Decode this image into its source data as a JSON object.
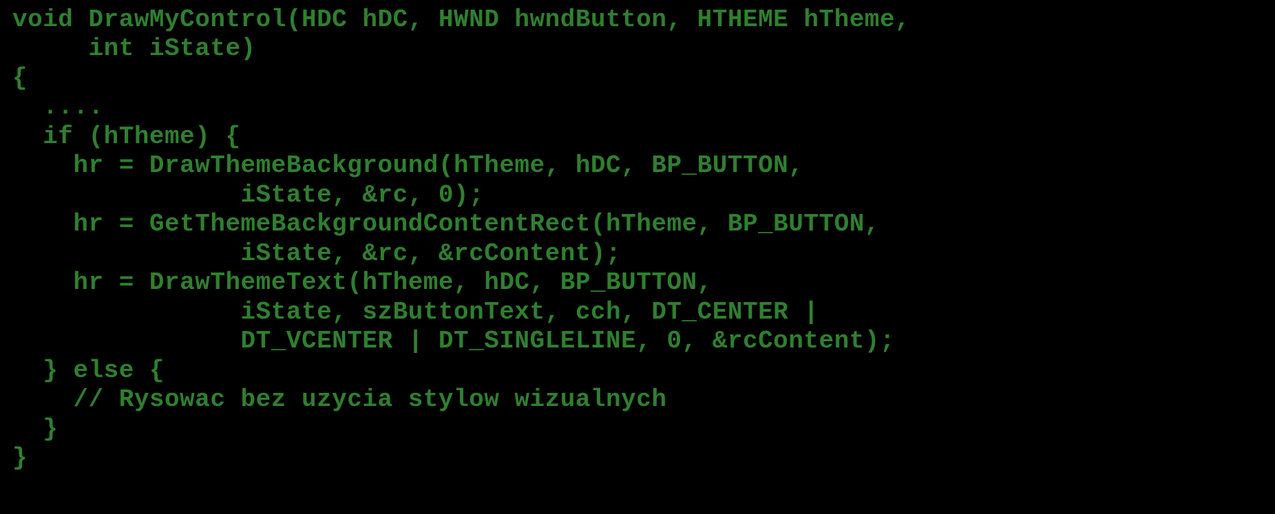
{
  "code": {
    "lines": [
      "void DrawMyControl(HDC hDC, HWND hwndButton, HTHEME hTheme,",
      "     int iState)",
      "{",
      "  ....",
      "  if (hTheme) {",
      "    hr = DrawThemeBackground(hTheme, hDC, BP_BUTTON,",
      "               iState, &rc, 0);",
      "    hr = GetThemeBackgroundContentRect(hTheme, BP_BUTTON,",
      "               iState, &rc, &rcContent);",
      "    hr = DrawThemeText(hTheme, hDC, BP_BUTTON,",
      "               iState, szButtonText, cch, DT_CENTER |",
      "               DT_VCENTER | DT_SINGLELINE, 0, &rcContent);",
      "  } else {",
      "    // Rysowac bez uzycia stylow wizualnych",
      "  }",
      "}"
    ]
  }
}
